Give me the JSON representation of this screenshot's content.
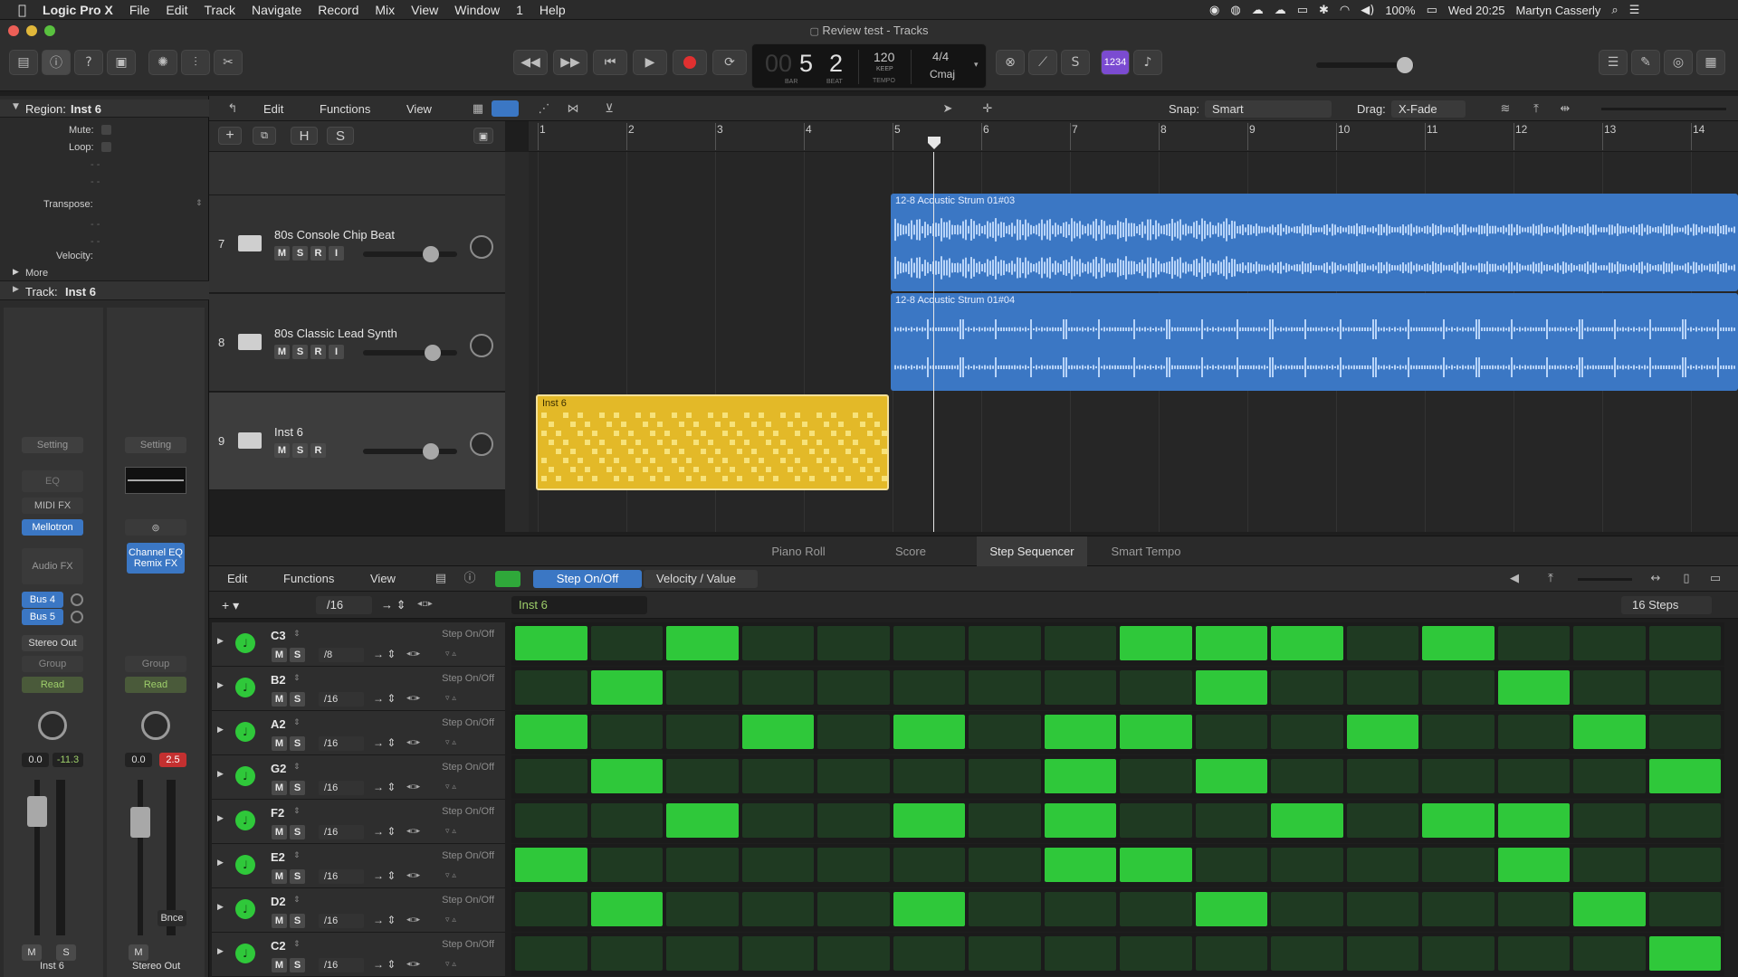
{
  "menubar": {
    "app": "Logic Pro X",
    "items": [
      "File",
      "Edit",
      "Track",
      "Navigate",
      "Record",
      "Mix",
      "View",
      "Window",
      "1",
      "Help"
    ],
    "status": {
      "battery": "100%",
      "datetime": "Wed 20:25",
      "user": "Martyn Casserly"
    }
  },
  "window": {
    "title": "Review test - Tracks"
  },
  "lcd": {
    "bar_prefix": "00",
    "bar": "5",
    "beat": "2",
    "bar_label": "BAR",
    "beat_label": "BEAT",
    "tempo": "120",
    "tempo_keep": "KEEP",
    "tempo_label": "TEMPO",
    "signature": "4/4",
    "key": "Cmaj"
  },
  "counter_button": "1234",
  "inspector": {
    "region_label": "Region:",
    "region_name": "Inst 6",
    "mute": "Mute:",
    "loop": "Loop:",
    "dash": "- -",
    "transpose": "Transpose:",
    "velocity": "Velocity:",
    "more": "More",
    "track_label": "Track:",
    "track_name": "Inst 6",
    "strip1": {
      "setting": "Setting",
      "eq": "EQ",
      "midi_fx": "MIDI FX",
      "instrument": "Mellotron",
      "audio_fx": "Audio FX",
      "sends": [
        "Bus 4",
        "Bus 5"
      ],
      "output": "Stereo Out",
      "group": "Group",
      "automation": "Read",
      "vol": "0.0",
      "peak": "-11.3",
      "m": "M",
      "s": "S",
      "name": "Inst 6"
    },
    "strip2": {
      "setting": "Setting",
      "fx1": "Channel EQ",
      "fx2": "Remix FX",
      "group": "Group",
      "automation": "Read",
      "vol": "0.0",
      "peak": "2.5",
      "m": "M",
      "bnce": "Bnce",
      "name": "Stereo Out"
    }
  },
  "tracks_toolbar": {
    "edit": "Edit",
    "functions": "Functions",
    "view": "View",
    "snap_label": "Snap:",
    "snap": "Smart",
    "drag_label": "Drag:",
    "drag": "X-Fade",
    "h": "H",
    "s": "S"
  },
  "ruler": [
    "1",
    "2",
    "3",
    "4",
    "5",
    "6",
    "7",
    "8",
    "9",
    "10",
    "11",
    "12",
    "13",
    "14"
  ],
  "tracks": [
    {
      "num": "7",
      "name": "80s Console Chip Beat",
      "buttons": [
        "M",
        "S",
        "R",
        "I"
      ],
      "fader": 0.72
    },
    {
      "num": "8",
      "name": "80s Classic Lead Synth",
      "buttons": [
        "M",
        "S",
        "R",
        "I"
      ],
      "fader": 0.74
    },
    {
      "num": "9",
      "name": "Inst 6",
      "buttons": [
        "M",
        "S",
        "R"
      ],
      "fader": 0.72
    }
  ],
  "regions": {
    "r1": "12-8 Acoustic Strum 01#03",
    "r2": "12-8 Acoustic Strum 01#04",
    "r3": "Inst 6"
  },
  "editor_tabs": [
    "Piano Roll",
    "Score",
    "Step Sequencer",
    "Smart Tempo"
  ],
  "seq_toolbar": {
    "edit": "Edit",
    "functions": "Functions",
    "view": "View",
    "mode_on": "Step On/Off",
    "mode_vel": "Velocity / Value",
    "division": "/16",
    "pattern": "Inst 6",
    "steps": "16 Steps"
  },
  "seq_rows": [
    {
      "note": "C3",
      "rate": "/8",
      "label": "Step On/Off",
      "steps": [
        1,
        0,
        1,
        0,
        0,
        0,
        0,
        0,
        1,
        1,
        1,
        0,
        1,
        0,
        0,
        0
      ]
    },
    {
      "note": "B2",
      "rate": "/16",
      "label": "Step On/Off",
      "steps": [
        0,
        1,
        0,
        0,
        0,
        0,
        0,
        0,
        0,
        1,
        0,
        0,
        0,
        1,
        0,
        0
      ]
    },
    {
      "note": "A2",
      "rate": "/16",
      "label": "Step On/Off",
      "steps": [
        1,
        0,
        0,
        1,
        0,
        1,
        0,
        1,
        1,
        0,
        0,
        1,
        0,
        0,
        1,
        0
      ]
    },
    {
      "note": "G2",
      "rate": "/16",
      "label": "Step On/Off",
      "steps": [
        0,
        1,
        0,
        0,
        0,
        0,
        0,
        1,
        0,
        1,
        0,
        0,
        0,
        0,
        0,
        1
      ]
    },
    {
      "note": "F2",
      "rate": "/16",
      "label": "Step On/Off",
      "steps": [
        0,
        0,
        1,
        0,
        0,
        1,
        0,
        1,
        0,
        0,
        1,
        0,
        1,
        1,
        0,
        0
      ]
    },
    {
      "note": "E2",
      "rate": "/16",
      "label": "Step On/Off",
      "steps": [
        1,
        0,
        0,
        0,
        0,
        0,
        0,
        1,
        1,
        0,
        0,
        0,
        0,
        1,
        0,
        0
      ]
    },
    {
      "note": "D2",
      "rate": "/16",
      "label": "Step On/Off",
      "steps": [
        0,
        1,
        0,
        0,
        0,
        1,
        0,
        0,
        0,
        1,
        0,
        0,
        0,
        0,
        1,
        0
      ]
    },
    {
      "note": "C2",
      "rate": "/16",
      "label": "Step On/Off",
      "steps": [
        0,
        0,
        0,
        0,
        0,
        0,
        0,
        0,
        0,
        0,
        0,
        0,
        0,
        0,
        0,
        1
      ]
    }
  ],
  "mslabels": {
    "m": "M",
    "s": "S"
  },
  "colors": {
    "accent_blue": "#3b77c4",
    "region_yellow": "#e3b928",
    "step_on": "#2fc83a",
    "record_red": "#e03030",
    "active_purple": "#7b4bd1"
  },
  "icons": {
    "play": "play-icon",
    "record": "record-icon",
    "cycle": "cycle-icon",
    "rewind": "rewind-icon",
    "forward": "forward-icon"
  }
}
